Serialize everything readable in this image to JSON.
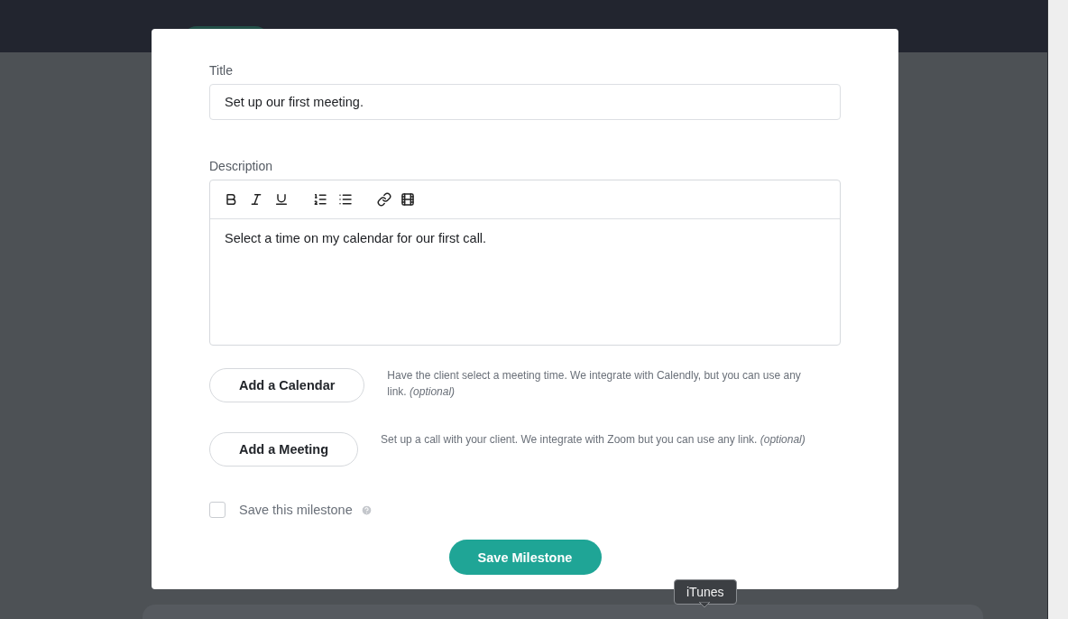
{
  "modal": {
    "title_field": {
      "label": "Title",
      "value": "Set up our first meeting."
    },
    "description": {
      "label": "Description",
      "toolbar": [
        {
          "kind": "bold"
        },
        {
          "kind": "italic"
        },
        {
          "kind": "underline"
        },
        {
          "kind": "ordered"
        },
        {
          "kind": "bullets"
        },
        {
          "kind": "link"
        },
        {
          "kind": "film"
        }
      ],
      "text": "Select a time on my calendar for our first call."
    },
    "actions": [
      {
        "button": "Add a Calendar",
        "hint": "Have the client select a meeting time. We integrate with Calendly, but you can use any link. *(optional)*"
      },
      {
        "button": "Add a Meeting",
        "hint": "Set up a call with your client. We integrate with Zoom but you can use any link. *(optional)*"
      }
    ],
    "save_checkbox": {
      "label": "Save this milestone",
      "checked": false
    },
    "submit": "Save Milestone"
  },
  "tooltip": "iTunes"
}
